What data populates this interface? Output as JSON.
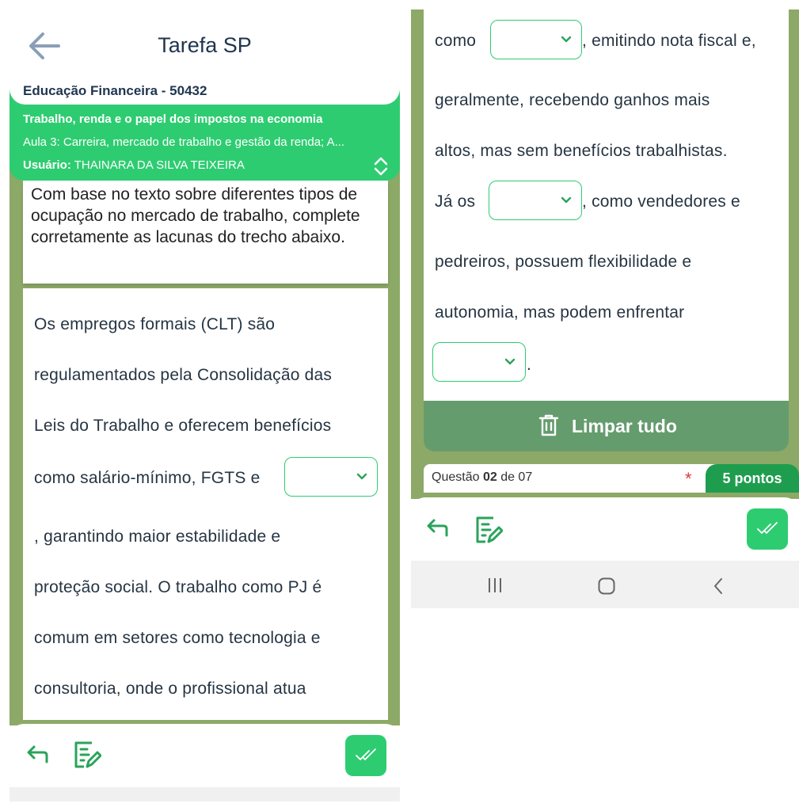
{
  "header": {
    "title": "Tarefa SP"
  },
  "info": {
    "course": "Educação Financeira - 50432",
    "subject": "Trabalho, renda e o papel dos impostos na economia",
    "lesson": "Aula 3: Carreira, mercado de trabalho e gestão da renda; A...",
    "user_label": "Usuário:",
    "user_name": "THAINARA DA SILVA TEIXEIRA"
  },
  "question": {
    "prompt": "Com base no texto sobre diferentes tipos de ocupação no mercado de trabalho, complete corretamente as lacunas do trecho abaixo."
  },
  "passage_left": {
    "l1": "Os empregos formais (CLT) são",
    "l2": "regulamentados pela Consolidação das",
    "l3": "Leis do Trabalho e oferecem benefícios",
    "l4": "como salário-mínimo, FGTS e",
    "l5": ", garantindo maior estabilidade e",
    "l6": "proteção social. O trabalho como PJ é",
    "l7": "comum em setores como tecnologia e",
    "l8": "consultoria, onde o profissional atua"
  },
  "passage_right": {
    "r1a": "como",
    "r1b": ", emitindo nota fiscal e,",
    "r2": "geralmente, recebendo ganhos mais",
    "r3": "altos, mas sem benefícios trabalhistas.",
    "r4a": "Já os",
    "r4b": ", como vendedores e",
    "r5": "pedreiros, possuem flexibilidade e",
    "r6": "autonomia, mas podem enfrentar",
    "r7": "."
  },
  "blanks": {
    "blank1": "",
    "blank2": "",
    "blank3": "",
    "blank4": ""
  },
  "actions": {
    "clear_all": "Limpar tudo"
  },
  "progress": {
    "label": "Questão",
    "current": "02",
    "of": "de 07",
    "required_mark": "*",
    "points": "5 pontos"
  },
  "colors": {
    "accent": "#2ecc71",
    "olive": "#8da967",
    "dark_green": "#1f9d4e",
    "title": "#1f3550"
  },
  "icons": [
    "back-arrow-icon",
    "expand-icon",
    "chevron-down-icon",
    "reply-icon",
    "edit-note-icon",
    "double-check-icon",
    "trash-icon",
    "recent-apps-icon",
    "home-icon",
    "back-icon"
  ]
}
